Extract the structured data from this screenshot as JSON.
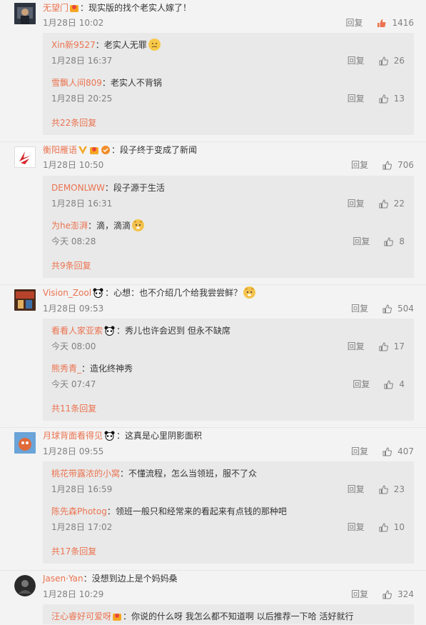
{
  "colors": {
    "username": "#eb7350",
    "meta": "#808080",
    "accent": "#eb7350",
    "liked": "#eb7350"
  },
  "comments": [
    {
      "user": "无望门",
      "text": "：现实版的找个老实人嫁了！",
      "date": "1月28日 10:02",
      "reply": "回复",
      "likes": "1416",
      "replies": [
        {
          "user": "Xin新9527",
          "text": "：老实人无罪",
          "date": "1月28日 16:37",
          "reply": "回复",
          "likes": "26"
        },
        {
          "user": "雪飘人间809",
          "text": "：老实人不背锅",
          "date": "1月28日 20:25",
          "reply": "回复",
          "likes": "13"
        }
      ],
      "more": "共22条回复"
    },
    {
      "user": "衡阳雁语",
      "text": "：段子终于变成了新闻",
      "date": "1月28日 10:50",
      "reply": "回复",
      "likes": "706",
      "replies": [
        {
          "user": "DEMONLWW",
          "text": "：段子源于生活",
          "date": "1月28日 16:31",
          "reply": "回复",
          "likes": "22"
        },
        {
          "user": "为he澎湃",
          "text": "：滴，滴滴",
          "date": "今天 08:28",
          "reply": "回复",
          "likes": "8"
        }
      ],
      "more": "共9条回复"
    },
    {
      "user": "Vision_Zool",
      "text": "：心想：也不介绍几个给我尝尝鲜？",
      "date": "1月28日 09:53",
      "reply": "回复",
      "likes": "504",
      "replies": [
        {
          "user": "看看人家亚索",
          "text": "：秀儿也许会迟到  但永不缺席",
          "date": "今天 08:00",
          "reply": "回复",
          "likes": "17"
        },
        {
          "user": "熊秀青_",
          "text": "：造化终神秀",
          "date": "今天 07:47",
          "reply": "回复",
          "likes": "4"
        }
      ],
      "more": "共11条回复"
    },
    {
      "user": "月球背面看得见",
      "text": "：这真是心里阴影面积",
      "date": "1月28日 09:55",
      "reply": "回复",
      "likes": "407",
      "replies": [
        {
          "user": "桃花带露浓的小窝",
          "text": "：不懂流程，怎么当领班，服不了众",
          "date": "1月28日 16:59",
          "reply": "回复",
          "likes": "23"
        },
        {
          "user": "陈先森Photog",
          "text": "：领班一般只和经常来的看起来有点钱的那种吧",
          "date": "1月28日 17:02",
          "reply": "回复",
          "likes": "10"
        }
      ],
      "more": "共17条回复"
    },
    {
      "user": "Jasen·Yan",
      "text": "：没想到边上是个妈妈桑",
      "date": "1月28日 10:29",
      "reply": "回复",
      "likes": "324",
      "replies": [
        {
          "user": "汪心睿好可爱呀",
          "text": "：你说的什么呀  我怎么都不知道啊   以后推荐一下哈   活好就行",
          "date": "",
          "reply": "",
          "likes": ""
        }
      ],
      "more": ""
    }
  ]
}
